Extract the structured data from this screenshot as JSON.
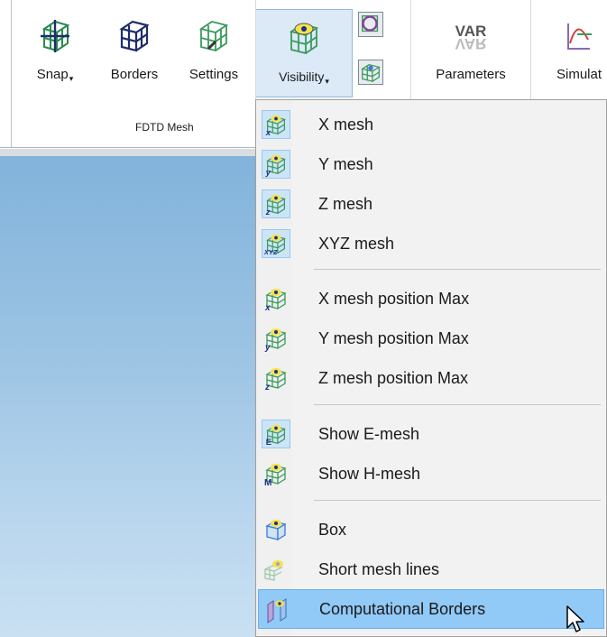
{
  "ribbon": {
    "buttons": [
      {
        "id": "snap",
        "label": "Snap",
        "has_caret": true,
        "icon": "snap-mesh-icon"
      },
      {
        "id": "borders",
        "label": "Borders",
        "has_caret": false,
        "icon": "borders-mesh-icon"
      },
      {
        "id": "settings",
        "label": "Settings",
        "has_caret": false,
        "icon": "mesh-settings-icon"
      },
      {
        "id": "visibility",
        "label": "Visibility",
        "has_caret": true,
        "icon": "mesh-visibility-icon"
      },
      {
        "id": "parameters",
        "label": "Parameters",
        "has_caret": false,
        "icon": "var-parameters-icon"
      },
      {
        "id": "simulate",
        "label": "Simulat",
        "has_caret": false,
        "icon": "simulate-icon"
      }
    ],
    "caret": "▾",
    "var_text": "VAR",
    "group_label": "FDTD Mesh"
  },
  "menu": {
    "items": [
      {
        "label": "X mesh",
        "icon": "x-mesh-icon",
        "checked": true
      },
      {
        "label": "Y mesh",
        "icon": "y-mesh-icon",
        "checked": true
      },
      {
        "label": "Z mesh",
        "icon": "z-mesh-icon",
        "checked": true
      },
      {
        "label": "XYZ mesh",
        "icon": "xyz-mesh-icon",
        "checked": true
      },
      {
        "label": "X mesh position Max",
        "icon": "x-mesh-position-icon",
        "checked": false
      },
      {
        "label": "Y mesh position Max",
        "icon": "y-mesh-position-icon",
        "checked": false
      },
      {
        "label": "Z mesh position Max",
        "icon": "z-mesh-position-icon",
        "checked": false
      },
      {
        "label": "Show E-mesh",
        "icon": "e-mesh-icon",
        "checked": true
      },
      {
        "label": "Show H-mesh",
        "icon": "h-mesh-icon",
        "checked": false
      },
      {
        "label": "Box",
        "icon": "box-icon",
        "checked": false
      },
      {
        "label": "Short mesh lines",
        "icon": "short-mesh-lines-icon",
        "checked": false
      },
      {
        "label": "Computational Borders",
        "icon": "computational-borders-icon",
        "checked": false,
        "highlighted": true
      }
    ]
  },
  "colors": {
    "mesh_green": "#3a9a5c",
    "mesh_navy": "#1d2d6b",
    "highlight": "#91c9f7",
    "checked_bg": "#cce4f7"
  }
}
